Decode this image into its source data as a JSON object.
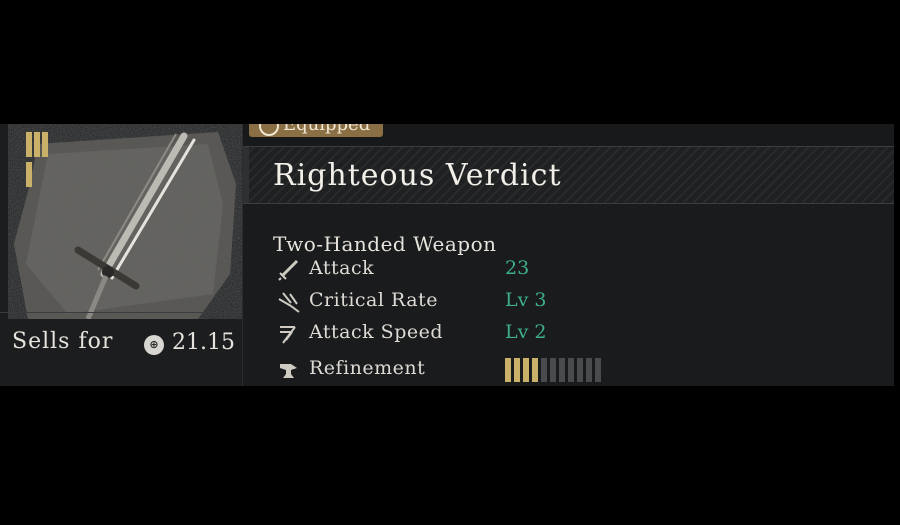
{
  "item": {
    "equipped_label": "Equipped",
    "title": "Righteous Verdict",
    "type": "Two-Handed Weapon",
    "sell_label": "Sells for",
    "sell_value": "21.15"
  },
  "stats": [
    {
      "label": "Attack",
      "value": "23",
      "icon": "sword-icon"
    },
    {
      "label": "Critical Rate",
      "value": "Lv 3",
      "icon": "critical-icon"
    },
    {
      "label": "Attack Speed",
      "value": "Lv 2",
      "icon": "speed-icon"
    }
  ],
  "refinement": {
    "label": "Refinement",
    "icon": "anvil-icon",
    "filled": 4,
    "total": 11
  },
  "colors": {
    "accent_gold": "#c9b16a",
    "stat_green": "#3fae8d",
    "text": "#e6e3dc"
  }
}
